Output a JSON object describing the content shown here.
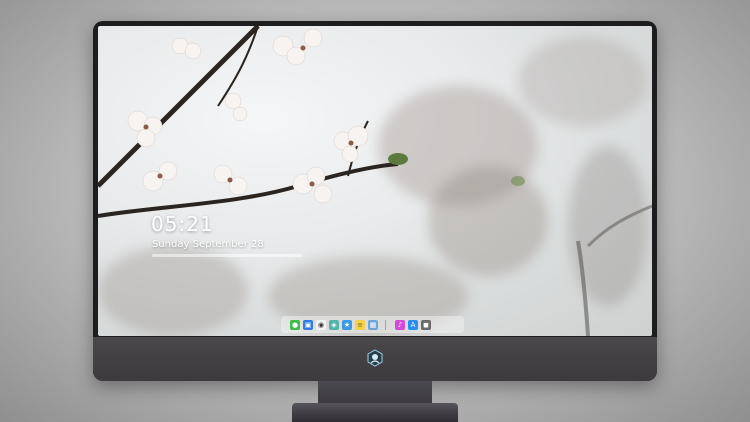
{
  "lock_screen": {
    "time": "05:21",
    "date": "Sunday September  28"
  },
  "dock": {
    "apps": [
      {
        "name": "messages-icon",
        "color": "#3bbf4a",
        "glyph": "●"
      },
      {
        "name": "finder-icon",
        "color": "#2f7de1",
        "glyph": "▣"
      },
      {
        "name": "safari-icon",
        "color": "#f2f2f2",
        "glyph": "◉"
      },
      {
        "name": "maps-icon",
        "color": "#56b3a8",
        "glyph": "◈"
      },
      {
        "name": "imovie-icon",
        "color": "#3c9be0",
        "glyph": "★"
      },
      {
        "name": "notes-icon",
        "color": "#f6d24b",
        "glyph": "≡"
      },
      {
        "name": "preview-icon",
        "color": "#6fa6d8",
        "glyph": "▦"
      }
    ],
    "apps_right": [
      {
        "name": "itunes-icon",
        "color": "#d44ad8",
        "glyph": "♪"
      },
      {
        "name": "app-store-icon",
        "color": "#2a8ef0",
        "glyph": "A"
      },
      {
        "name": "camera-icon",
        "color": "#6a6a6a",
        "glyph": "◼"
      }
    ]
  },
  "colors": {
    "bezel": "#1d1d1f",
    "chin": "#444144",
    "stand": "#4b4950"
  }
}
